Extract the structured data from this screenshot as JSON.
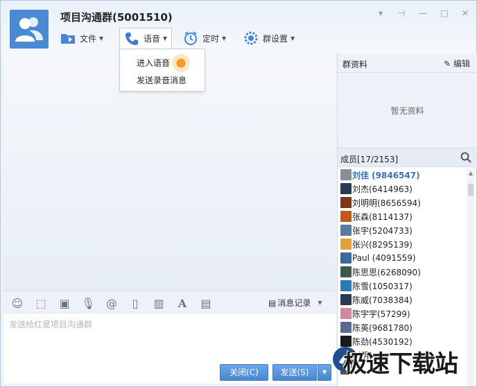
{
  "window": {
    "title": "项目沟通群(5001510)",
    "controls": [
      "pin-icon",
      "dock-icon",
      "minimize-icon",
      "maximize-icon",
      "close-icon"
    ]
  },
  "toolbar": {
    "file_label": "文件",
    "voice_label": "语音",
    "timer_label": "定时",
    "group_settings_label": "群设置"
  },
  "voice_menu": {
    "items": [
      "进入语音",
      "发送录音消息"
    ]
  },
  "input": {
    "placeholder": "发送给红星项目沟通群",
    "history_label": "消息记录",
    "close_label": "关闭(C)",
    "send_label": "发送(S)"
  },
  "side": {
    "info_title": "群资料",
    "edit_label": "编辑",
    "no_data": "暂无资料",
    "members_title": "成员[17/2153]",
    "members": [
      {
        "name": "刘佳 (9846547)",
        "color": "#8a8f96"
      },
      {
        "name": "刘杰(6414963)",
        "color": "#2b3a55"
      },
      {
        "name": "刘明明(8656594)",
        "color": "#7a3a18"
      },
      {
        "name": "张森(8114137)",
        "color": "#c05a20"
      },
      {
        "name": "张宇(5204733)",
        "color": "#5a7aa0"
      },
      {
        "name": "张兴(8295139)",
        "color": "#e0a040"
      },
      {
        "name": "Paul (4091559)",
        "color": "#3a6a9a"
      },
      {
        "name": "陈思思(6268090)",
        "color": "#3a5a4a"
      },
      {
        "name": "陈雪(1050317)",
        "color": "#2a7ab8"
      },
      {
        "name": "陈威(7038384)",
        "color": "#2a3a50"
      },
      {
        "name": "陈宇宇(57299)",
        "color": "#d08aa0"
      },
      {
        "name": "陈英(9681780)",
        "color": "#5a6a90"
      },
      {
        "name": "陈劲(4530192)",
        "color": "#1a1a1a"
      },
      {
        "name": "刘明(...)",
        "color": "#a04020"
      },
      {
        "name": "...(...)",
        "color": "#6a4a3a"
      }
    ]
  },
  "watermark": "极速下载站"
}
